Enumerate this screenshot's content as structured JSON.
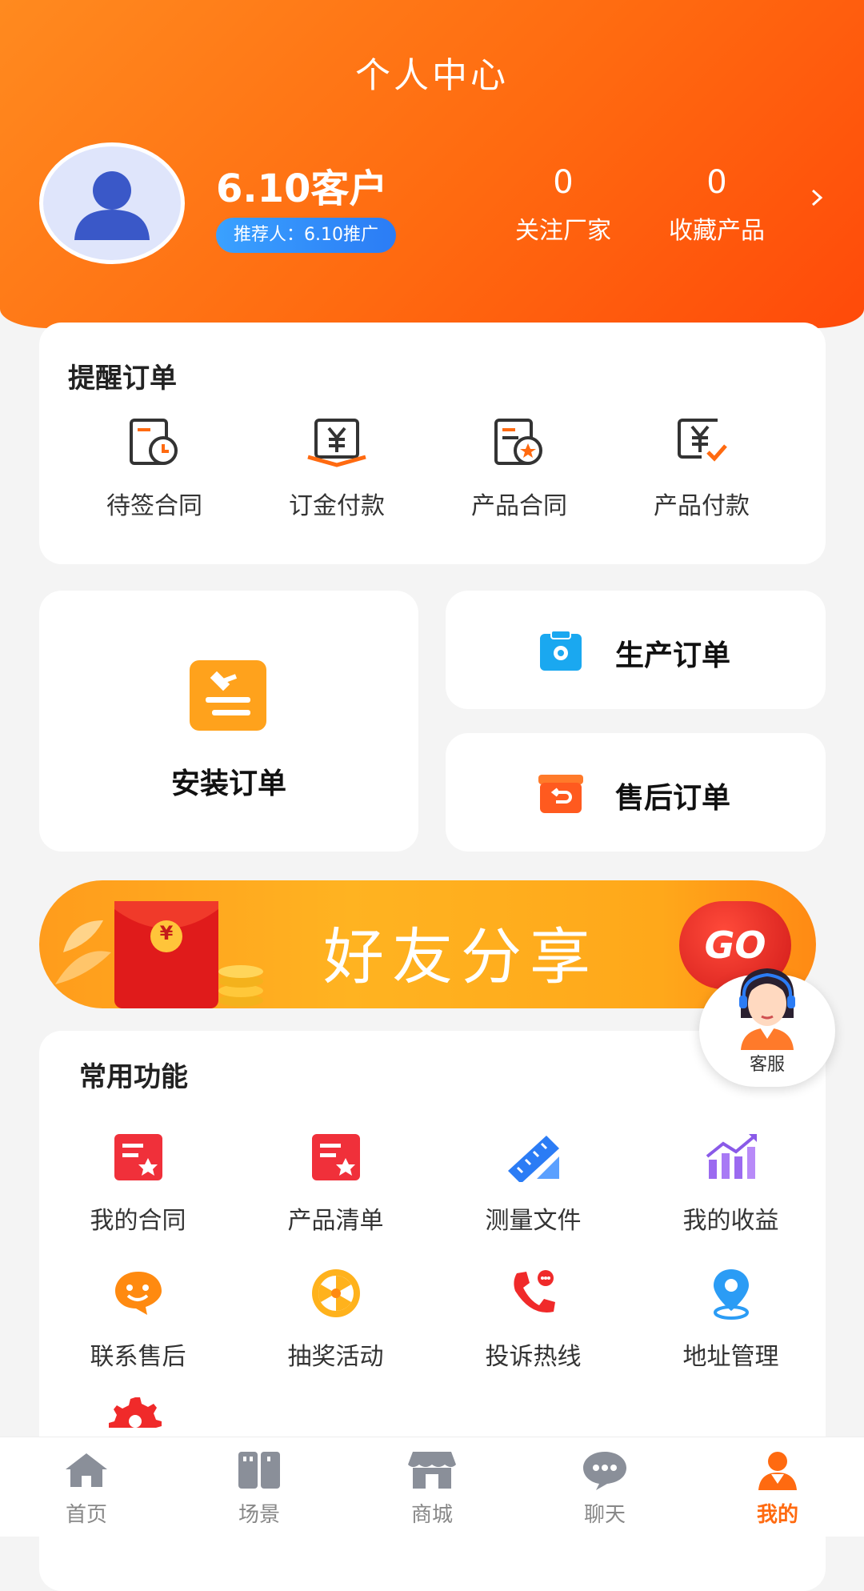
{
  "header": {
    "title": "个人中心",
    "username": "6.10客户",
    "referrer": "推荐人：6.10推广",
    "stats": [
      {
        "value": "0",
        "label": "关注厂家"
      },
      {
        "value": "0",
        "label": "收藏产品"
      }
    ]
  },
  "reminder": {
    "title": "提醒订单",
    "items": [
      {
        "label": "待签合同",
        "icon": "contract-clock-icon"
      },
      {
        "label": "订金付款",
        "icon": "yuan-payment-icon"
      },
      {
        "label": "产品合同",
        "icon": "contract-star-icon"
      },
      {
        "label": "产品付款",
        "icon": "yuan-check-icon"
      }
    ]
  },
  "orders": {
    "install": "安装订单",
    "production": "生产订单",
    "after_sales": "售后订单"
  },
  "banner": {
    "text": "好友分享",
    "go": "GO",
    "envelope_symbol": "¥"
  },
  "service": {
    "label": "客服"
  },
  "functions": {
    "title": "常用功能",
    "row1": [
      {
        "label": "我的合同",
        "icon": "contract-star-icon"
      },
      {
        "label": "产品清单",
        "icon": "list-star-icon"
      },
      {
        "label": "测量文件",
        "icon": "ruler-icon"
      },
      {
        "label": "我的收益",
        "icon": "chart-up-icon"
      }
    ],
    "row2": [
      {
        "label": "联系售后",
        "icon": "chat-face-icon"
      },
      {
        "label": "抽奖活动",
        "icon": "wheel-icon"
      },
      {
        "label": "投诉热线",
        "icon": "phone-icon"
      },
      {
        "label": "地址管理",
        "icon": "location-pin-icon"
      }
    ]
  },
  "tabbar": [
    {
      "label": "首页",
      "icon": "home-icon"
    },
    {
      "label": "场景",
      "icon": "scene-icon"
    },
    {
      "label": "商城",
      "icon": "store-icon"
    },
    {
      "label": "聊天",
      "icon": "chat-icon"
    },
    {
      "label": "我的",
      "icon": "user-icon",
      "active": true
    }
  ],
  "colors": {
    "accent": "#ff6a10",
    "blue": "#2b7cf5",
    "text": "#333333"
  }
}
